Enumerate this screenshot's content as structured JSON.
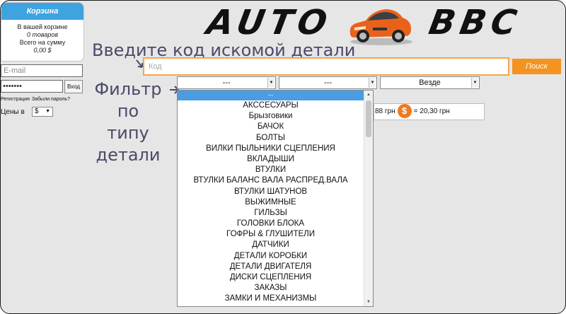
{
  "cart": {
    "title": "Корзина",
    "line1": "В вашей корзине",
    "items": "0 товаров",
    "line3": "Всего на сумму",
    "total": "0,00 $"
  },
  "login": {
    "email_placeholder": "E-mail",
    "password_mask": "•••••••",
    "button": "Вход",
    "register": "Регистрация",
    "forgot": "Забыли пароль?",
    "prices_label": "Цены в",
    "currency": "$"
  },
  "logo": {
    "left": "AUTO",
    "right": "BBC"
  },
  "annotations": {
    "code": "Введите код искомой детали",
    "filter_lines": [
      "Фильтр",
      "по",
      "типу",
      "детали"
    ]
  },
  "search": {
    "placeholder": "Код",
    "button": "Поиск"
  },
  "filters": {
    "type_value": "---",
    "second_value": "---",
    "where_value": "Везде"
  },
  "rate": {
    "left": "88 грн",
    "right": "= 20,30 грн"
  },
  "dropdown": {
    "selected": "---",
    "options": [
      "АКССЕСУАРЫ",
      "Брызговики",
      "БАЧОК",
      "БОЛТЫ",
      "ВИЛКИ ПЫЛЬНИКИ СЦЕПЛЕНИЯ",
      "ВКЛАДЫШИ",
      "ВТУЛКИ",
      "ВТУЛКИ БАЛАНС ВАЛА РАСПРЕД.ВАЛА",
      "ВТУЛКИ ШАТУНОВ",
      "ВЫЖИМНЫЕ",
      "ГИЛЬЗЫ",
      "ГОЛОВКИ БЛОКА",
      "ГОФРЫ & ГЛУШИТЕЛИ",
      "ДАТЧИКИ",
      "ДЕТАЛИ КОРОБКИ",
      "ДЕТАЛИ ДВИГАТЕЛЯ",
      "ДИСКИ СЦЕПЛЕНИЯ",
      "ЗАКАЗЫ",
      "ЗАМКИ И МЕХАНИЗМЫ"
    ]
  },
  "colors": {
    "accent_blue": "#3fa3df",
    "accent_orange": "#f49320",
    "annotation": "#4a4a6a"
  }
}
